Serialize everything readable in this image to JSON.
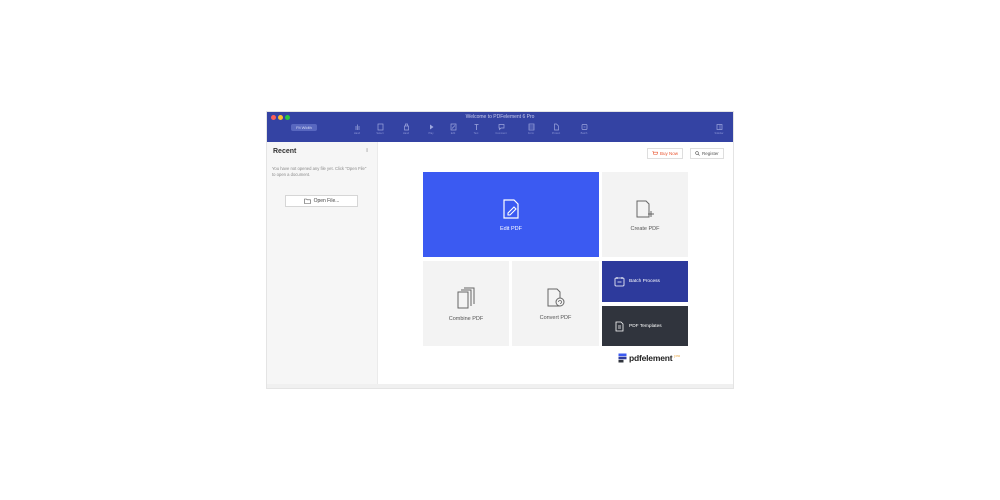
{
  "window": {
    "title": "Welcome to PDFelement 6 Pro",
    "zoom": "Fit Width",
    "traffic_colors": [
      "#fc5f57",
      "#fdbc2e",
      "#28c840"
    ]
  },
  "toolbar": {
    "tools": [
      {
        "label": "Hand",
        "icon": "hand-icon"
      },
      {
        "label": "Select",
        "icon": "select-icon"
      },
      {
        "label": "Hand",
        "icon": "pan-icon"
      },
      {
        "label": "Play",
        "icon": "play-icon"
      },
      {
        "label": "Edit",
        "icon": "edit-icon"
      },
      {
        "label": "Text",
        "icon": "text-icon"
      },
      {
        "label": "Comment",
        "icon": "comment-icon"
      },
      {
        "label": "Form",
        "icon": "form-icon"
      },
      {
        "label": "Protect",
        "icon": "protect-icon"
      },
      {
        "label": "Convert",
        "icon": "convert-icon"
      },
      {
        "label": "Batch",
        "icon": "batch-icon"
      },
      {
        "label": "Sidebar",
        "icon": "sidebar-icon"
      }
    ]
  },
  "sidebar": {
    "title": "Recent",
    "hint": "You have not opened any file yet. Click \"Open File\" to open a document.",
    "open_file_label": "Open File..."
  },
  "header": {
    "buy_now": "Buy Now",
    "register": "Register"
  },
  "tiles": {
    "edit_pdf": "Edit PDF",
    "create_pdf": "Create PDF",
    "combine_pdf": "Combine PDF",
    "convert_pdf": "Convert PDF",
    "batch_process": "Batch Process",
    "pdf_templates": "PDF Templates"
  },
  "brand": {
    "name": "pdfelement",
    "suffix": "pro"
  },
  "colors": {
    "titlebar": "#3443a3",
    "edit_tile": "#3b5af2",
    "batch_tile": "#2d3a9c",
    "templates_tile": "#30343d",
    "buy_now": "#e9542f"
  }
}
